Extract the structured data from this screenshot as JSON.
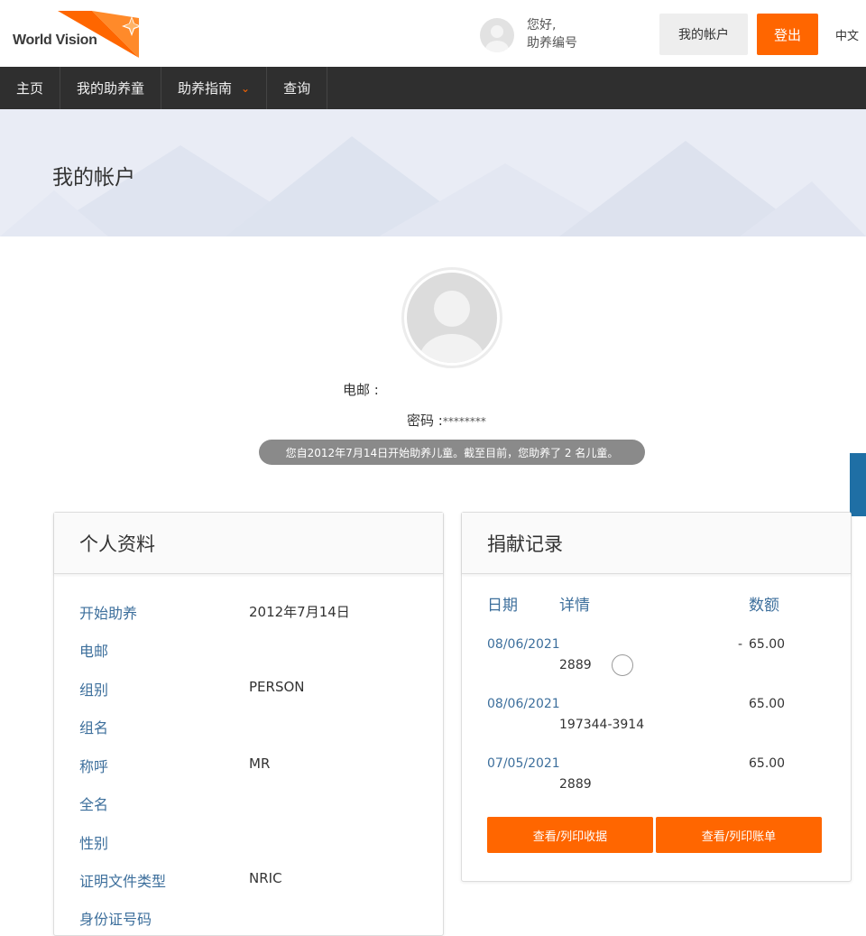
{
  "header": {
    "logo_text": "World Vision",
    "greeting_line1": "您好,",
    "greeting_line2": "助养编号",
    "account_button": "我的帐户",
    "logout_button": "登出",
    "language": "中文"
  },
  "nav": {
    "items": [
      {
        "label": "主页"
      },
      {
        "label": "我的助养童"
      },
      {
        "label": "助养指南"
      },
      {
        "label": "查询"
      }
    ]
  },
  "banner": {
    "title": "我的帐户"
  },
  "profile": {
    "email_label": "电邮 :",
    "password_label": "密码 :",
    "password_mask": "********",
    "summary": "您自2012年7月14日开始助养儿童。截至目前，您助养了 2 名儿童。"
  },
  "personal_panel": {
    "title": "个人资料",
    "fields": [
      {
        "label": "开始助养",
        "value": "2012年7月14日"
      },
      {
        "label": "电邮",
        "value": ""
      },
      {
        "label": "组别",
        "value": "PERSON"
      },
      {
        "label": "组名",
        "value": ""
      },
      {
        "label": "称呼",
        "value": "MR"
      },
      {
        "label": "全名",
        "value": ""
      },
      {
        "label": "性别",
        "value": ""
      },
      {
        "label": "证明文件类型",
        "value": "NRIC"
      },
      {
        "label": "身份证号码",
        "value": ""
      }
    ]
  },
  "donation_panel": {
    "title": "捐献记录",
    "col_date": "日期",
    "col_detail": "详情",
    "col_amount": "数额",
    "rows": [
      {
        "date": "08/06/2021",
        "detail": "2889",
        "amount": "65.00",
        "dash": "-"
      },
      {
        "date": "08/06/2021",
        "detail": "197344-3914",
        "amount": "65.00",
        "dash": ""
      },
      {
        "date": "07/05/2021",
        "detail": "2889",
        "amount": "65.00",
        "dash": ""
      }
    ],
    "receipt_button": "查看/列印收据",
    "statement_button": "查看/列印账单"
  },
  "colors": {
    "accent": "#ff6600",
    "nav_bg": "#2f2f2f",
    "label_blue": "#3d6f9c"
  }
}
